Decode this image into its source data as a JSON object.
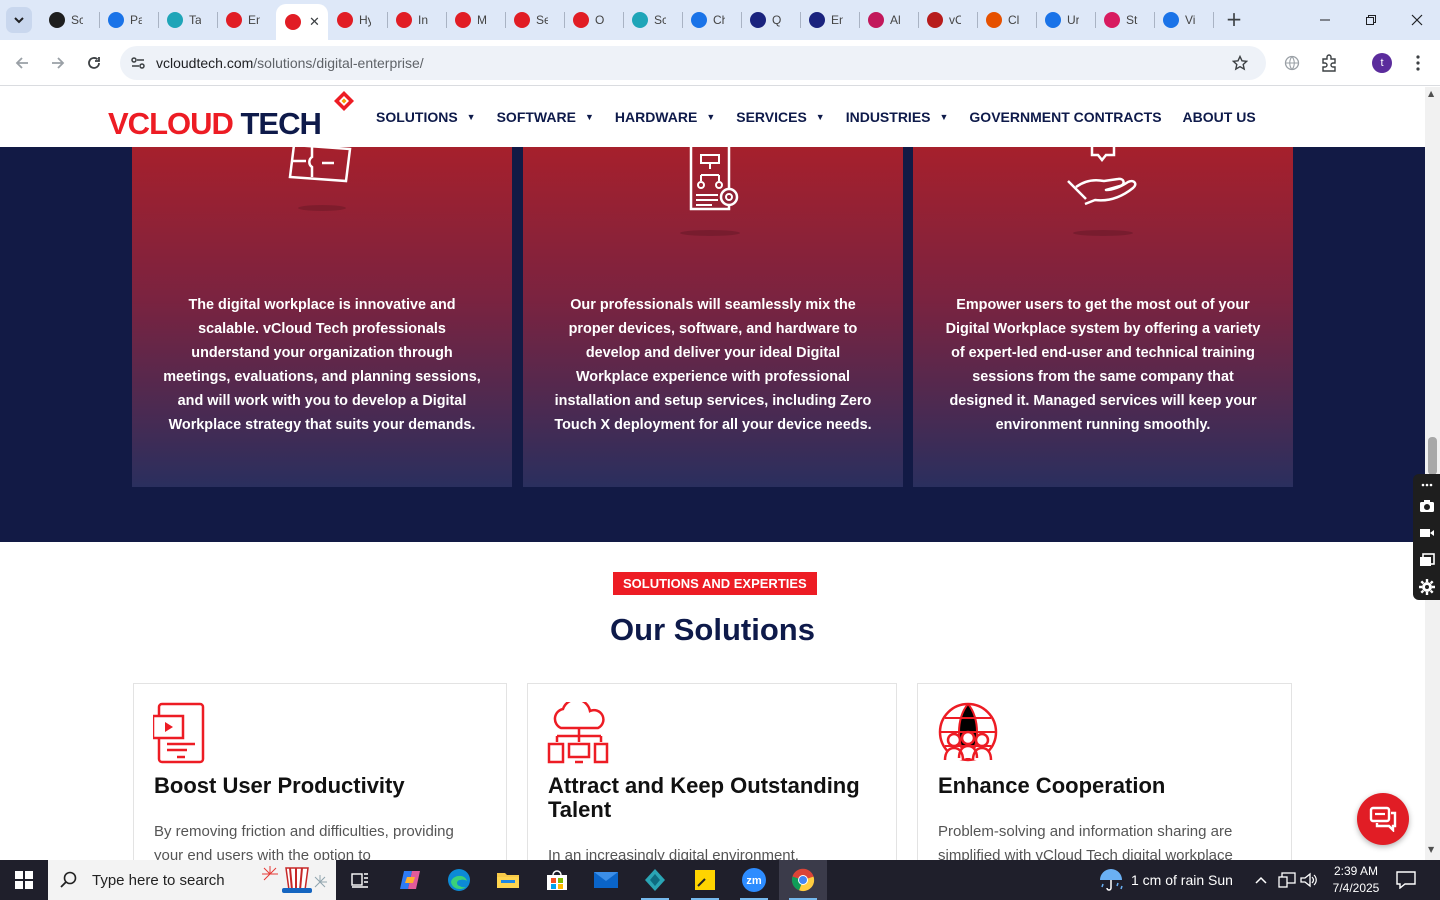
{
  "browser": {
    "tabs": [
      {
        "label": "Sc",
        "icon": "github-icon",
        "color": "#1f1f1f"
      },
      {
        "label": "Pa",
        "icon": "gauge-icon",
        "color": "#1a73e8"
      },
      {
        "label": "Ta",
        "icon": "circle-app-icon",
        "color": "#1fa5b8"
      },
      {
        "label": "En",
        "icon": "vcloud-diamond-icon",
        "color": "#e11d25"
      },
      {
        "label": "",
        "icon": "vcloud-diamond-icon",
        "color": "#e11d25",
        "active": true
      },
      {
        "label": "Hy",
        "icon": "vcloud-diamond-icon",
        "color": "#e11d25"
      },
      {
        "label": "In",
        "icon": "vcloud-diamond-icon",
        "color": "#e11d25"
      },
      {
        "label": "M",
        "icon": "vcloud-diamond-icon",
        "color": "#e11d25"
      },
      {
        "label": "Se",
        "icon": "vcloud-diamond-icon",
        "color": "#e11d25"
      },
      {
        "label": "O",
        "icon": "vcloud-diamond-icon",
        "color": "#e11d25"
      },
      {
        "label": "Sc",
        "icon": "circle-app-icon",
        "color": "#1fa5b8"
      },
      {
        "label": "Ch",
        "icon": "scales-icon",
        "color": "#1a73e8"
      },
      {
        "label": "Q",
        "icon": "x-logo-icon",
        "color": "#1a237e"
      },
      {
        "label": "En",
        "icon": "check-pen-icon",
        "color": "#1a237e"
      },
      {
        "label": "Al",
        "icon": "ball-icon",
        "color": "#c2185b"
      },
      {
        "label": "vC",
        "icon": "v-check-icon",
        "color": "#b71c1c"
      },
      {
        "label": "Cl",
        "icon": "brush-icon",
        "color": "#e65100"
      },
      {
        "label": "Ur",
        "icon": "doc-icon",
        "color": "#1a73e8"
      },
      {
        "label": "St",
        "icon": "pen-icon",
        "color": "#d81b60"
      },
      {
        "label": "Vi",
        "icon": "pulse-icon",
        "color": "#1a73e8"
      }
    ],
    "url_domain": "vcloudtech.com",
    "url_path": "/solutions/digital-enterprise/",
    "profile_initial": "t"
  },
  "site": {
    "logo": {
      "part1": "VCLOUD ",
      "part2": "TECH"
    },
    "nav": [
      {
        "label": "SOLUTIONS",
        "caret": true
      },
      {
        "label": "SOFTWARE",
        "caret": true
      },
      {
        "label": "HARDWARE",
        "caret": true
      },
      {
        "label": "SERVICES",
        "caret": true
      },
      {
        "label": "INDUSTRIES",
        "caret": true
      },
      {
        "label": "GOVERNMENT CONTRACTS",
        "caret": false
      },
      {
        "label": "ABOUT US",
        "caret": false
      }
    ],
    "cards": [
      {
        "text": "The digital workplace is innovative and scalable. vCloud Tech professionals understand your organization through meetings, evaluations, and planning sessions, and will work with you to develop a Digital Workplace strategy that suits your demands."
      },
      {
        "text": "Our professionals will seamlessly mix the proper devices, software, and hardware to develop and deliver your ideal Digital Workplace experience with professional installation and setup services, including Zero Touch X deployment for all your device needs."
      },
      {
        "text": "Empower users to get the most out of your Digital Workplace system by offering a variety of expert-led end-user and technical training sessions from the same company that designed it. Managed services will keep your environment running smoothly."
      }
    ],
    "section_badge": "SOLUTIONS AND EXPERTIES",
    "section_title": "Our Solutions",
    "solutions": [
      {
        "title": "Boost User Productivity",
        "desc": "By removing friction and difficulties, providing your end users with the option to"
      },
      {
        "title": "Attract and Keep Outstanding Talent",
        "desc": "In an increasingly digital environment,"
      },
      {
        "title": "Enhance Cooperation",
        "desc": "Problem-solving and information sharing are simplified with vCloud Tech digital workplace"
      }
    ]
  },
  "taskbar": {
    "search_placeholder": "Type here to search",
    "weather": "1 cm of rain  Sun",
    "time": "2:39 AM",
    "date": "7/4/2025"
  },
  "colors": {
    "brand_red": "#ed1c24",
    "brand_navy": "#0e1a4a",
    "band": "#121a45"
  }
}
